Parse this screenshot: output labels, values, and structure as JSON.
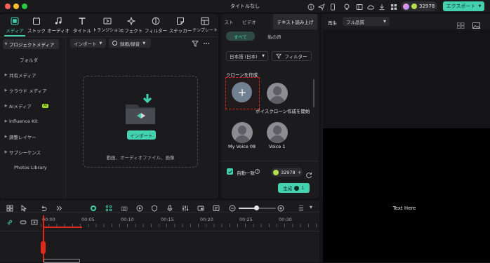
{
  "window": {
    "title": "タイトルなし",
    "credits": "32978",
    "export_label": "エクスポート",
    "traffic_lights": [
      "#ff5f57",
      "#febc2e",
      "#28c840"
    ]
  },
  "colors": {
    "accent": "#43d1b0",
    "panel_bg": "#1b1b1e",
    "app_bg": "#141416",
    "highlight_box": "#e0281b"
  },
  "nav_tabs": [
    {
      "label": "メディア",
      "icon": "media-icon",
      "active": true
    },
    {
      "label": "ストック",
      "icon": "stock-icon"
    },
    {
      "label": "オーディオ",
      "icon": "audio-icon"
    },
    {
      "label": "タイトル",
      "icon": "title-icon"
    },
    {
      "label": "トランジション",
      "icon": "transition-icon"
    },
    {
      "label": "エフェクト",
      "icon": "effect-icon"
    },
    {
      "label": "フィルター",
      "icon": "filter-icon"
    },
    {
      "label": "ステッカー",
      "icon": "sticker-icon"
    },
    {
      "label": "テンプレート",
      "icon": "template-icon"
    }
  ],
  "sidebar": {
    "items": [
      {
        "label": "プロジェクトメディア",
        "selected": true
      },
      {
        "label": "フォルダ"
      },
      {
        "label": "共有メディア"
      },
      {
        "label": "クラウド メディア"
      },
      {
        "label": "AIメディア",
        "badge": "AI"
      },
      {
        "label": "Influence Kit"
      },
      {
        "label": "調整レイヤー"
      },
      {
        "label": "サブシーケンス"
      },
      {
        "label": "Photos Library"
      }
    ]
  },
  "media_toolbar": {
    "import_label": "インポート",
    "record_label": "録画/録音"
  },
  "dropzone": {
    "button_label": "インポート",
    "hint": "動画、オーディオファイル、画像"
  },
  "tts_panel": {
    "tabs": [
      {
        "label": "スト"
      },
      {
        "label": "ビデオ"
      },
      {
        "label": "テキスト読み上げ",
        "active": true
      }
    ],
    "subtabs": [
      {
        "label": "すべて",
        "active": true
      },
      {
        "label": "私の声"
      }
    ],
    "language": "日本語 (日本)",
    "filter_label": "フィルター",
    "section_title": "クローンを作成",
    "voices": [
      {
        "label": "",
        "type": "add"
      },
      {
        "label": "ボイスクローン作成を開始",
        "type": "avatar"
      },
      {
        "label": "My Voice 08",
        "type": "avatar"
      },
      {
        "label": "Voice 1",
        "type": "avatar"
      }
    ],
    "auto_match_label": "自動一致",
    "auto_match_checked": true,
    "credits": "32978",
    "generate_label": "生成",
    "generate_count": "1"
  },
  "preview": {
    "play_label": "再生",
    "quality": "フル品質",
    "overlay_text": "Text Here"
  },
  "timeline": {
    "ticks": [
      "00:00",
      "00:05",
      "00:10",
      "00:15",
      "00:20",
      "00:25",
      "00:30"
    ],
    "zoom_level": 0.78
  }
}
